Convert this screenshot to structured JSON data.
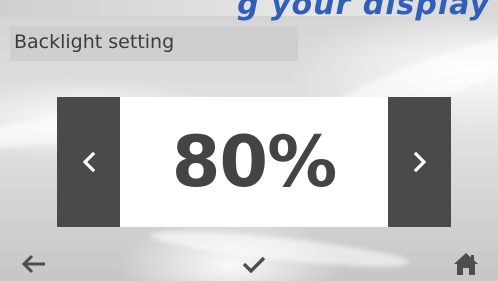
{
  "header": {
    "partial_title": "g your display"
  },
  "screen": {
    "title": "Backlight setting",
    "value": "80%",
    "decrease_icon": "chevron-left-icon",
    "increase_icon": "chevron-right-icon"
  },
  "footer": {
    "back_icon": "arrow-left-icon",
    "confirm_icon": "checkmark-icon",
    "home_icon": "home-icon"
  },
  "colors": {
    "header_text": "#2f5fb8",
    "button_bg": "#4a4a4a",
    "value_text": "#444444",
    "icon": "#4d4d4d"
  }
}
